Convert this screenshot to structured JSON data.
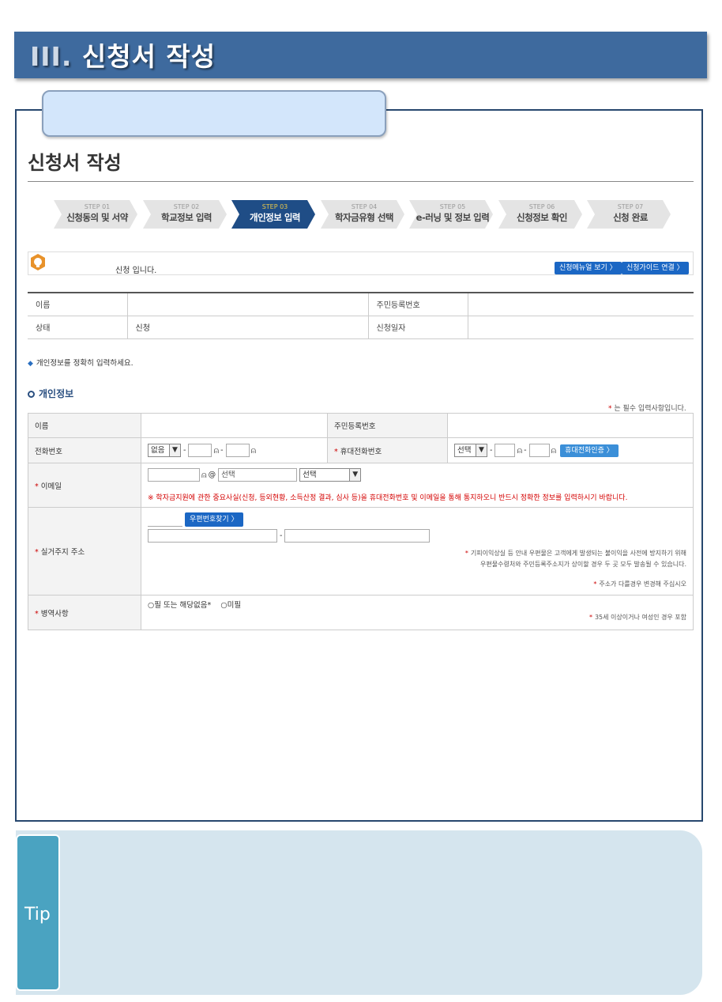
{
  "banner": {
    "numeral": "III.",
    "title": " 신청서 작성"
  },
  "page": {
    "title": "신청서 작성"
  },
  "steps": [
    {
      "num": "STEP 01",
      "name": "신청동의 및 서약",
      "active": false
    },
    {
      "num": "STEP 02",
      "name": "학교정보 입력",
      "active": false
    },
    {
      "num": "STEP 03",
      "name": "개인정보 입력",
      "active": true
    },
    {
      "num": "STEP 04",
      "name": "학자금유형 선택",
      "active": false
    },
    {
      "num": "STEP 05",
      "name": "e-러닝 및 정보 입력",
      "active": false
    },
    {
      "num": "STEP 06",
      "name": "신청정보 확인",
      "active": false
    },
    {
      "num": "STEP 07",
      "name": "신청 완료",
      "active": false
    }
  ],
  "infobar": {
    "text": "신청 입니다.",
    "manual_btn": "신청메뉴얼 보기 〉",
    "guide_btn": "신청가이드 연결 〉"
  },
  "summary": {
    "name_label": "이름",
    "name_value": "",
    "rrn_label": "주민등록번호",
    "rrn_value": "",
    "status_label": "상태",
    "status_value": "신청",
    "date_label": "신청일자",
    "date_value": ""
  },
  "notice": "개인정보를 정확히 입력하세요.",
  "section": {
    "title": "개인정보",
    "required_note": " 는 필수 입력사항입니다."
  },
  "form": {
    "name_label": "이름",
    "rrn_label": "주민등록번호",
    "phone_label": "전화번호",
    "phone_prefix": "없음",
    "mobile_label": "휴대전화번호",
    "mobile_prefix": "선택",
    "mobile_verify_btn": "휴대전화인증 〉",
    "email_label": "이메일",
    "email_domain_placeholder": "선택",
    "email_domain_select": "선택",
    "email_warning": "※ 학자금지원에 관한 중요사실(신청, 등외현황, 소득산정 결과, 심사 등)을 휴대전화번호 및 이메일을 통해 통지하오니 반드시 정확한 정보를 입력하시기 바랍니다.",
    "address_label": "실거주지 주소",
    "zip_btn": "우편번호찾기 〉",
    "address_note1": "기피이익상실 등 안내 우편물은 고객에게 발생되는 불이익을 사전에 방지하기 위해",
    "address_note2": "우편물수령처와 주민등록주소지가 상이할 경우 두 곳 모두 발송될 수 있습니다.",
    "address_note3": "주소가 다를경우 변경해 주십시오",
    "military_label": "병역사항",
    "military_opt1": "필 또는 해당없음*",
    "military_opt2": "미필",
    "military_note": "35세 이상이거나 여성인 경우 포함"
  },
  "tip": {
    "label": "Tip"
  },
  "colors": {
    "banner": "#3e6a9e",
    "step_active": "#1f4d86",
    "button": "#1b67c4",
    "tip_bg": "#d5e5ee",
    "tip_tab": "#4aa3c1"
  }
}
